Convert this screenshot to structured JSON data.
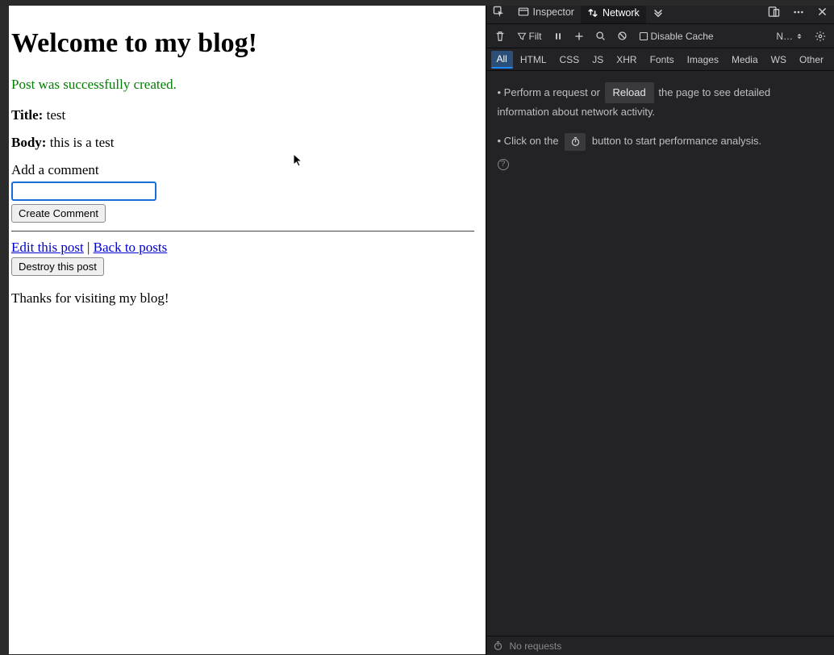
{
  "page": {
    "heading": "Welcome to my blog!",
    "flash": "Post was successfully created.",
    "title_label": "Title:",
    "title_value": "test",
    "body_label": "Body:",
    "body_value": "this is a test",
    "comment_label": "Add a comment",
    "comment_value": "",
    "create_comment_btn": "Create Comment",
    "edit_link": "Edit this post",
    "sep": "|",
    "back_link": "Back to posts",
    "destroy_btn": "Destroy this post",
    "footer": "Thanks for visiting my blog!"
  },
  "devtools": {
    "tabs": {
      "inspector": "Inspector",
      "network": "Network"
    },
    "toolbar": {
      "filter_placeholder": "Filt",
      "disable_cache": "Disable Cache",
      "throttle": "N…"
    },
    "filters": {
      "all": "All",
      "html": "HTML",
      "css": "CSS",
      "js": "JS",
      "xhr": "XHR",
      "fonts": "Fonts",
      "images": "Images",
      "media": "Media",
      "ws": "WS",
      "other": "Other"
    },
    "body": {
      "line1a": "• Perform a request or",
      "reload": "Reload",
      "line1b": "the page to see detailed information about network activity.",
      "line2a": "• Click on the",
      "line2b": "button to start performance analysis."
    },
    "status": "No requests"
  }
}
